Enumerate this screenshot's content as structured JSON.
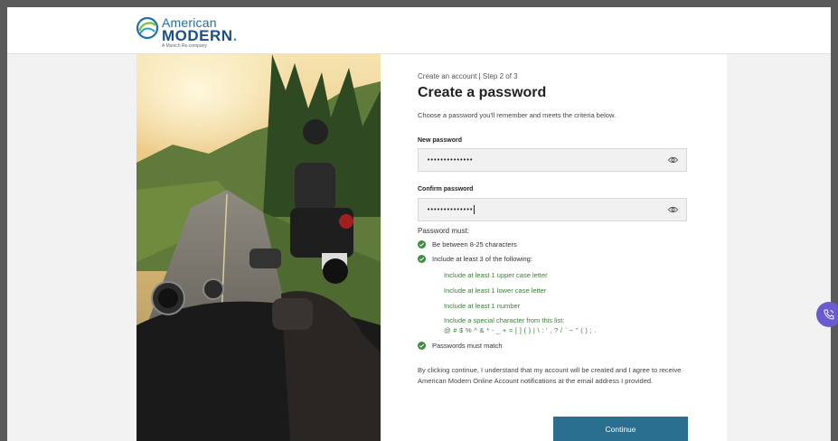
{
  "header": {
    "logo_line1": "American",
    "logo_line2": "MODERN",
    "logo_dot": ".",
    "logo_tagline": "A Munich Re company"
  },
  "form": {
    "step": "Create an account | Step 2 of 3",
    "title": "Create a password",
    "subtitle": "Choose a password you'll remember and meets the criteria below.",
    "new_password_label": "New password",
    "new_password_value": "••••••••••••••",
    "confirm_password_label": "Confirm password",
    "confirm_password_value": "••••••••••••••",
    "rules_title": "Password must:",
    "rules": [
      "Be between 8-25 characters",
      "Include at least 3 of the following:",
      "Passwords must match"
    ],
    "sub_rules": [
      "Include at least 1 upper case letter",
      "Include at least 1 lower case letter",
      "Include at least 1 number",
      "Include a special character from this list:"
    ],
    "special_chars": "@ # $ % ^ & * - _ + = [ ] { } | \\ : ' , ? / ` ~ \" ( ) ; .",
    "disclaimer": "By clicking continue, I understand that my account will be created and I agree to receive American Modern Online Account notifications at the email address I provided.",
    "continue_label": "Continue"
  },
  "colors": {
    "brand": "#1a4f8a",
    "button": "#2a6f8f",
    "success": "#3e7d3a",
    "chat": "#6b5bd1"
  },
  "icons": {
    "logo": "globe-swirl-icon",
    "password_toggle": "eye-icon",
    "rule_status": "check-circle-icon",
    "chat": "phone-chat-icon"
  }
}
